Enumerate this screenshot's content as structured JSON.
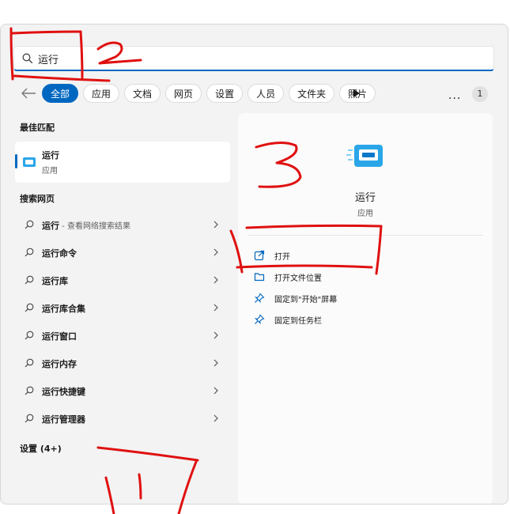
{
  "search": {
    "value": "运行"
  },
  "filters": {
    "tabs": [
      "全部",
      "应用",
      "文档",
      "网页",
      "设置",
      "人员",
      "文件夹",
      "照片"
    ],
    "more": "···",
    "badge": "1"
  },
  "left": {
    "best_match_title": "最佳匹配",
    "best_match": {
      "name": "运行",
      "type": "应用"
    },
    "web_title": "搜索网页",
    "web_items": [
      {
        "label": "运行",
        "sub": " - 查看网络搜索结果"
      },
      {
        "label": "运行命令",
        "sub": ""
      },
      {
        "label": "运行库",
        "sub": ""
      },
      {
        "label": "运行库合集",
        "sub": ""
      },
      {
        "label": "运行窗口",
        "sub": ""
      },
      {
        "label": "运行内存",
        "sub": ""
      },
      {
        "label": "运行快捷键",
        "sub": ""
      },
      {
        "label": "运行管理器",
        "sub": ""
      }
    ],
    "settings_title": "设置 (4+)"
  },
  "right": {
    "app_name": "运行",
    "app_type": "应用",
    "actions": [
      {
        "label": "打开",
        "icon": "open-external-icon"
      },
      {
        "label": "打开文件位置",
        "icon": "folder-icon"
      },
      {
        "label": "固定到\"开始\"屏幕",
        "icon": "pin-icon"
      },
      {
        "label": "固定到任务栏",
        "icon": "pin-icon"
      }
    ]
  },
  "colors": {
    "accent": "#0067c0",
    "annotation": "#e01010",
    "panel": "#fbfbfb",
    "window": "#f3f3f3"
  },
  "annotations": [
    "2",
    "3"
  ]
}
